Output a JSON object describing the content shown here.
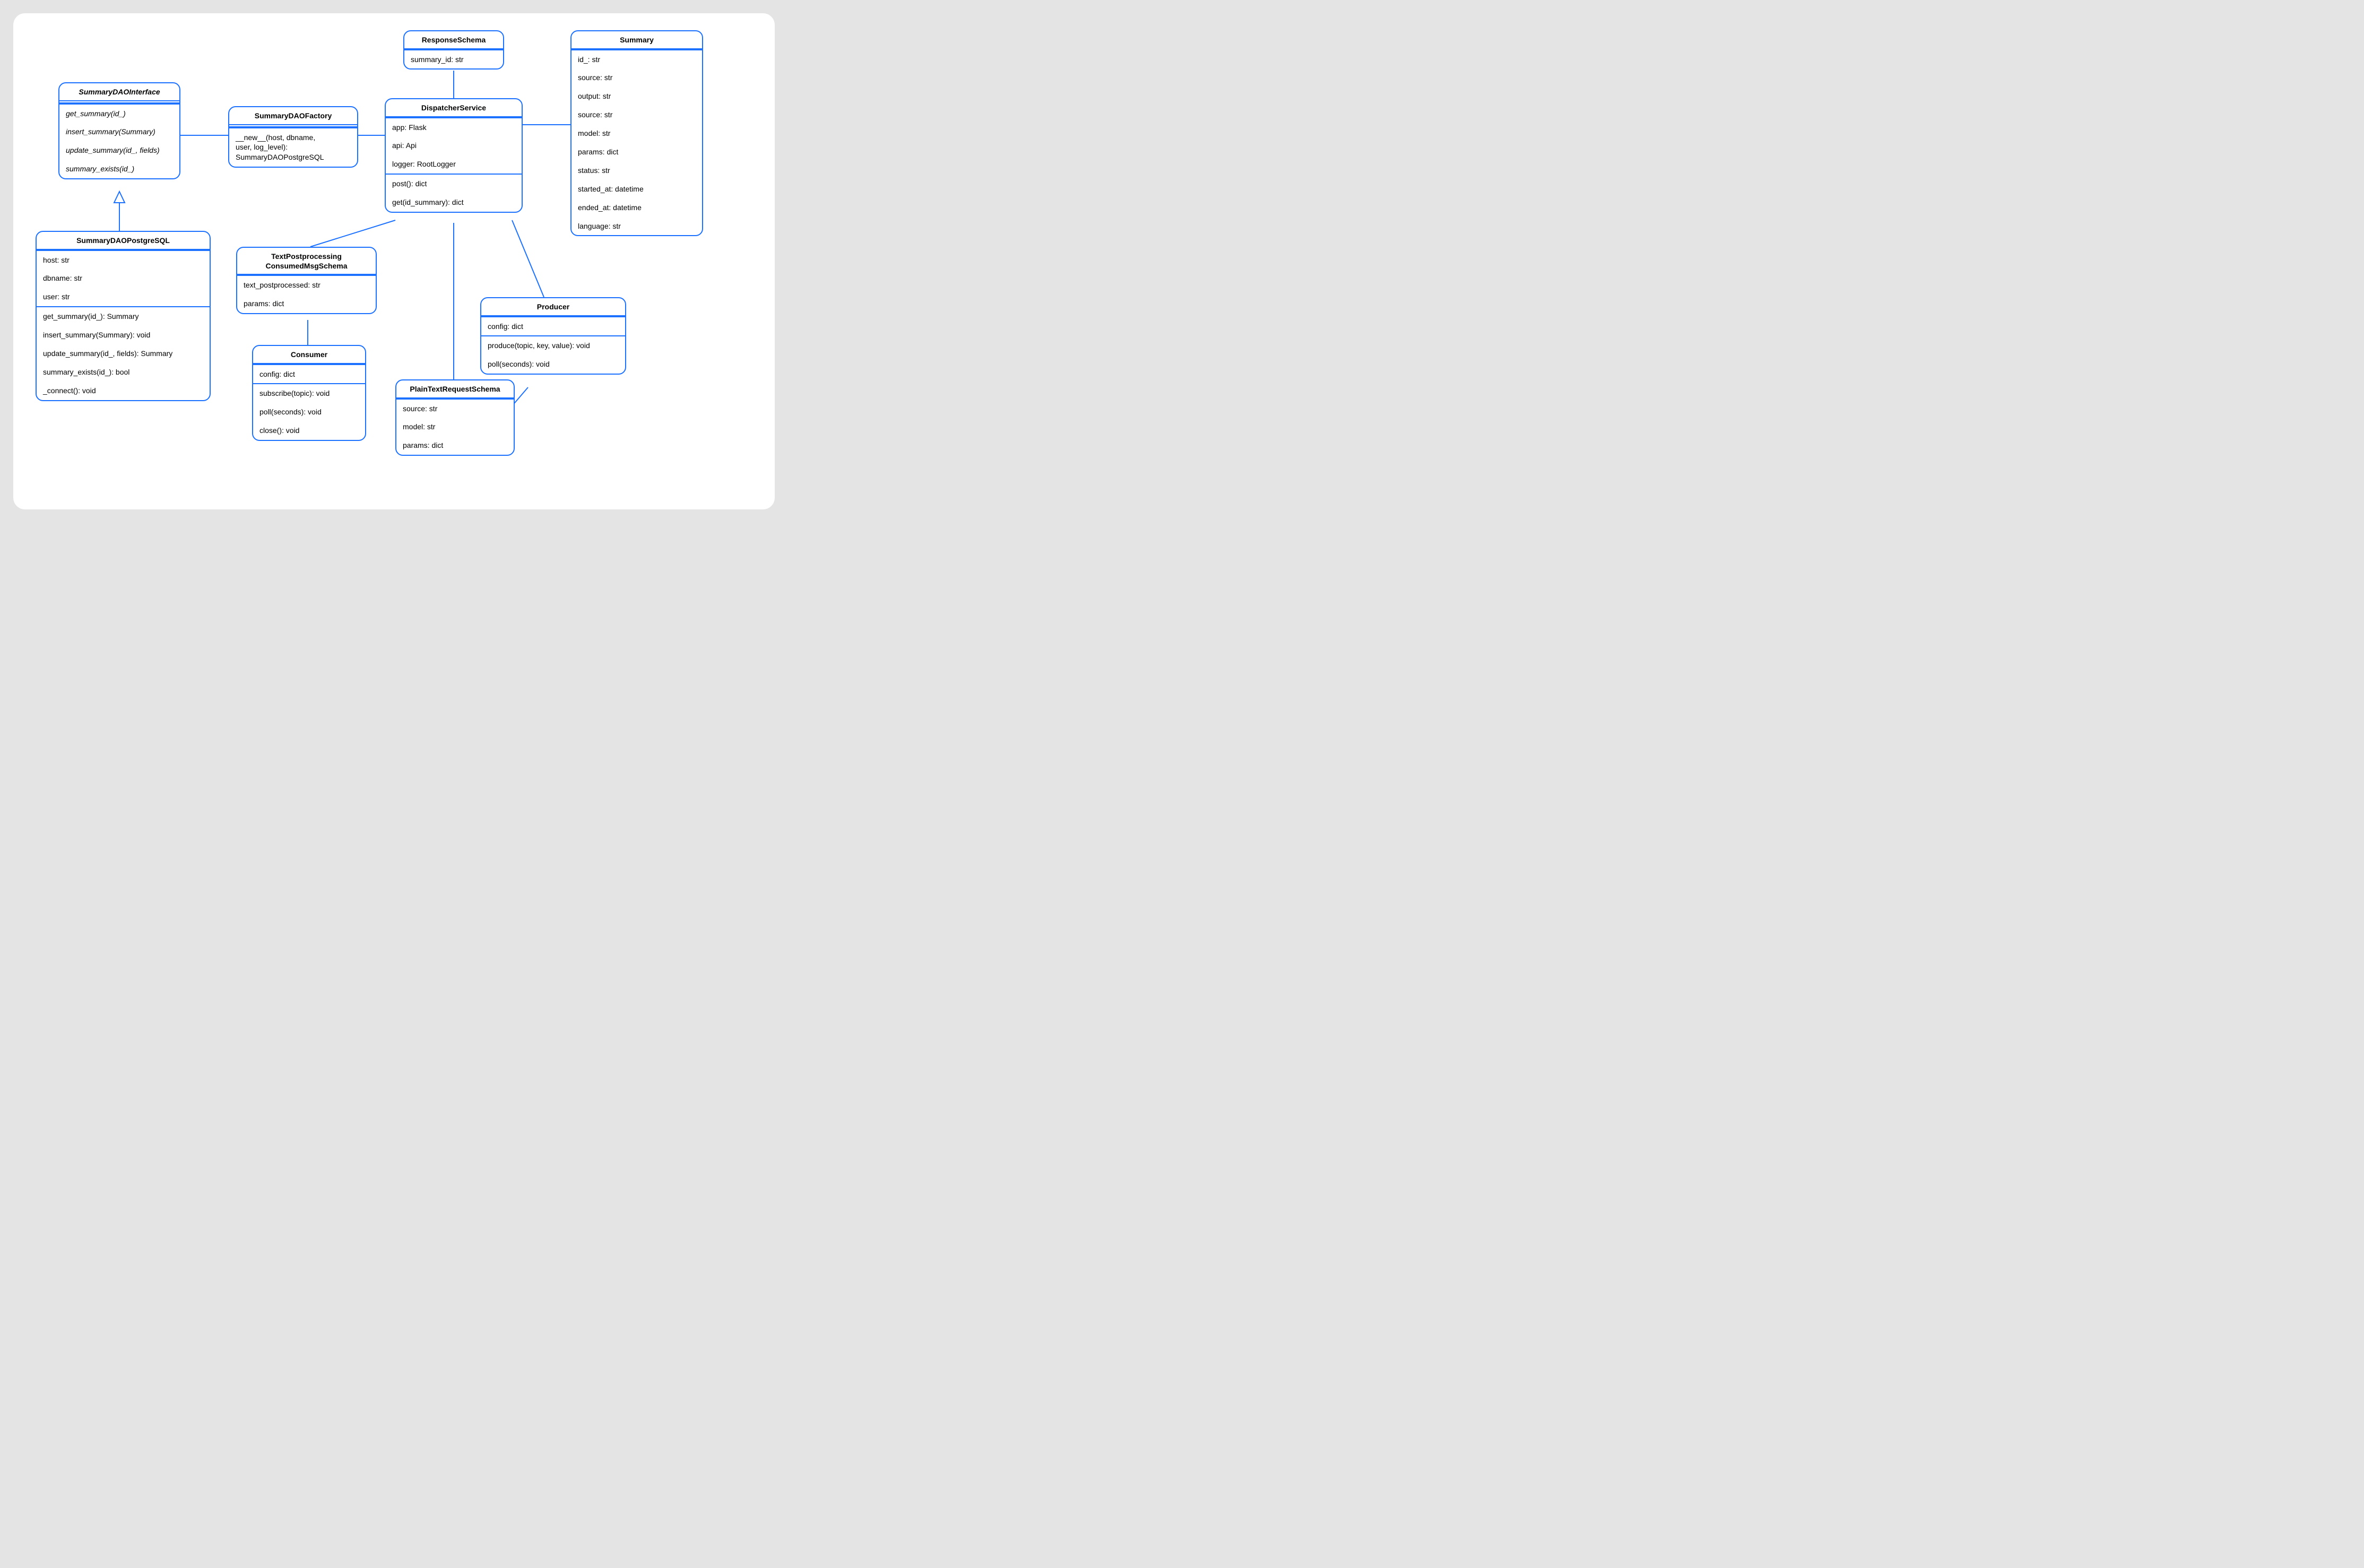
{
  "classes": {
    "SummaryDAOInterface": {
      "title": "SummaryDAOInterface",
      "members": [
        "get_summary(id_)",
        "insert_summary(Summary)",
        "update_summary(id_, fields)",
        "summary_exists(id_)"
      ]
    },
    "SummaryDAOFactory": {
      "title": "SummaryDAOFactory",
      "members": [
        "__new__(host, dbname,\n                  user, log_level):\nSummaryDAOPostgreSQL"
      ]
    },
    "SummaryDAOPostgreSQL": {
      "title": "SummaryDAOPostgreSQL",
      "attrs": [
        "host: str",
        "dbname: str",
        "user: str"
      ],
      "methods": [
        "get_summary(id_): Summary",
        "insert_summary(Summary): void",
        "update_summary(id_, fields): Summary",
        "summary_exists(id_): bool",
        "_connect(): void"
      ]
    },
    "ResponseSchema": {
      "title": "ResponseSchema",
      "attrs": [
        "summary_id: str"
      ]
    },
    "DispatcherService": {
      "title": "DispatcherService",
      "attrs": [
        "app: Flask",
        "api: Api",
        "logger: RootLogger"
      ],
      "methods": [
        "post(): dict",
        "get(id_summary): dict"
      ]
    },
    "Summary": {
      "title": "Summary",
      "attrs": [
        "id_: str",
        "source: str",
        "output: str",
        "source: str",
        "model: str",
        "params: dict",
        "status: str",
        "started_at: datetime",
        "ended_at: datetime",
        "language: str"
      ]
    },
    "TextPostprocessingConsumedMsgSchema": {
      "title": "TextPostprocessing\nConsumedMsgSchema",
      "attrs": [
        "text_postprocessed: str",
        "params: dict"
      ]
    },
    "Consumer": {
      "title": "Consumer",
      "attrs": [
        "config: dict"
      ],
      "methods": [
        "subscribe(topic): void",
        "poll(seconds): void",
        "close(): void"
      ]
    },
    "Producer": {
      "title": "Producer",
      "attrs": [
        "config: dict"
      ],
      "methods": [
        "produce(topic, key, value): void",
        "poll(seconds): void"
      ]
    },
    "PlainTextRequestSchema": {
      "title": "PlainTextRequestSchema",
      "attrs": [
        "source: str",
        "model: str",
        "params: dict"
      ]
    }
  }
}
